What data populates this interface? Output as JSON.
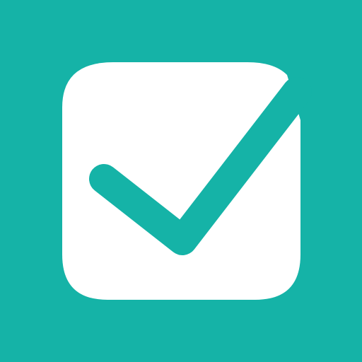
{
  "app_icon": {
    "icon_name": "checkbox-checked-icon",
    "background_color": "#15b3a7",
    "box_color": "#ffffff",
    "checkmark_color": "#15b3a7"
  }
}
